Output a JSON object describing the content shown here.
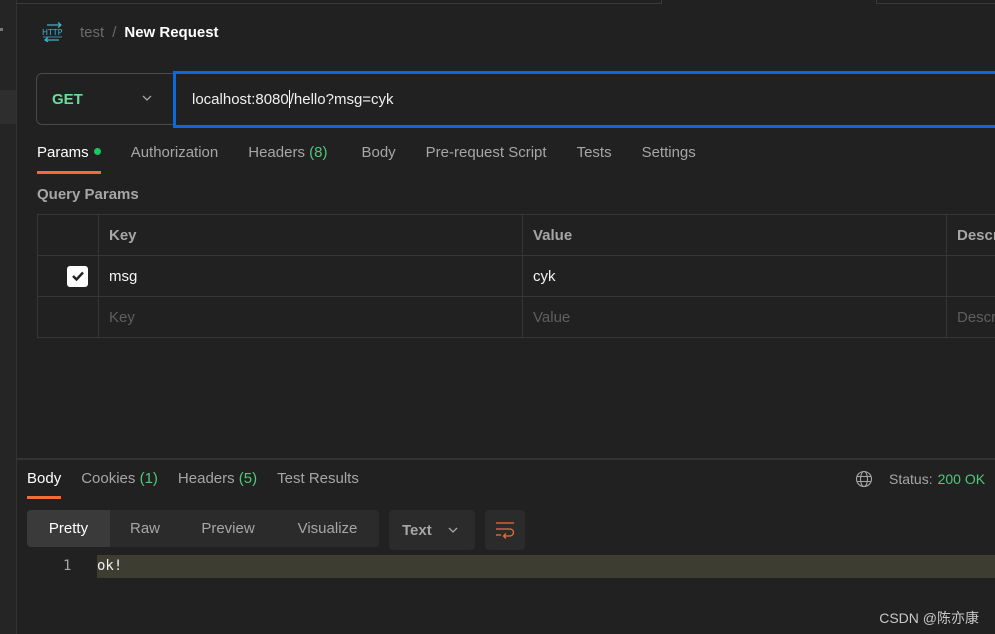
{
  "breadcrumb": {
    "icon": "http-icon",
    "parent": "test",
    "separator": "/",
    "current": "New Request"
  },
  "request": {
    "method": "GET",
    "url_before_caret": "localhost:8080",
    "url_after_caret": "/hello?msg=cyk"
  },
  "request_tabs": [
    {
      "label": "Params",
      "active": true,
      "badge": ""
    },
    {
      "label": "Authorization",
      "badge": ""
    },
    {
      "label": "Headers",
      "badge": "(8)"
    },
    {
      "label": "Body",
      "badge": ""
    },
    {
      "label": "Pre-request Script",
      "badge": ""
    },
    {
      "label": "Tests",
      "badge": ""
    },
    {
      "label": "Settings",
      "badge": ""
    }
  ],
  "query_params": {
    "section_label": "Query Params",
    "columns": [
      "Key",
      "Value",
      "Descr"
    ],
    "rows": [
      {
        "checked": true,
        "key": "msg",
        "value": "cyk",
        "description": ""
      }
    ],
    "placeholders": {
      "key": "Key",
      "value": "Value",
      "description": "Descr"
    }
  },
  "response_tabs": [
    {
      "label": "Body",
      "active": true,
      "badge": ""
    },
    {
      "label": "Cookies",
      "badge": "(1)"
    },
    {
      "label": "Headers",
      "badge": "(5)"
    },
    {
      "label": "Test Results",
      "badge": ""
    }
  ],
  "status": {
    "label": "Status:",
    "value": "200 OK",
    "icon": "globe-icon"
  },
  "view_modes": [
    "Pretty",
    "Raw",
    "Preview",
    "Visualize"
  ],
  "active_view_mode": "Pretty",
  "format": "Text",
  "response_body": [
    {
      "line": "1",
      "text": "ok!"
    }
  ],
  "watermark": "CSDN @陈亦康",
  "colors": {
    "accent": "#f26b3a",
    "url_focus": "#0a6bd8",
    "method_get": "#6bdd9a",
    "success": "#4ec87a"
  }
}
